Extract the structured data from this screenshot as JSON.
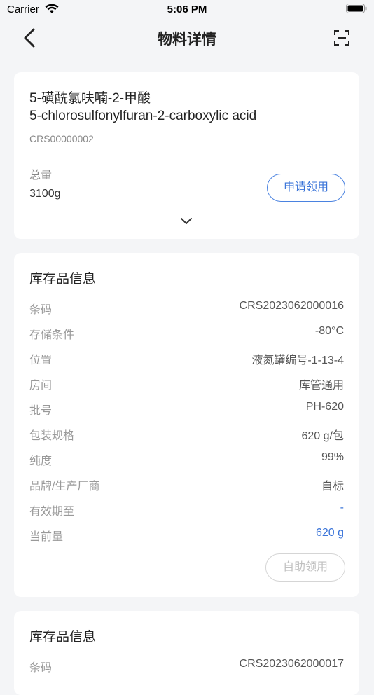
{
  "status_bar": {
    "carrier": "Carrier",
    "time": "5:06 PM"
  },
  "navbar": {
    "title": "物料详情"
  },
  "material": {
    "name_cn": "5-磺酰氯呋喃-2-甲酸",
    "name_en": "5-chlorosulfonylfuran-2-carboxylic acid",
    "code": "CRS00000002",
    "total_label": "总量",
    "total_value": "3100g",
    "apply_button": "申请领用"
  },
  "inventory": [
    {
      "title": "库存品信息",
      "rows": [
        {
          "label": "条码",
          "value": "CRS2023062000016"
        },
        {
          "label": "存储条件",
          "value": "-80°C"
        },
        {
          "label": "位置",
          "value": "液氮罐编号-1-13-4"
        },
        {
          "label": "房间",
          "value": "库管通用"
        },
        {
          "label": "批号",
          "value": "PH-620"
        },
        {
          "label": "包装规格",
          "value": "620 g/包"
        },
        {
          "label": "纯度",
          "value": "99%"
        },
        {
          "label": "品牌/生产厂商",
          "value": "自标"
        },
        {
          "label": "有效期至",
          "value": "-"
        },
        {
          "label": "当前量",
          "value": "620 g"
        }
      ],
      "self_button": "自助领用"
    },
    {
      "title": "库存品信息",
      "rows": [
        {
          "label": "条码",
          "value": "CRS2023062000017"
        }
      ]
    }
  ],
  "colors": {
    "accent": "#3a74d9",
    "background": "#f4f5f7"
  }
}
